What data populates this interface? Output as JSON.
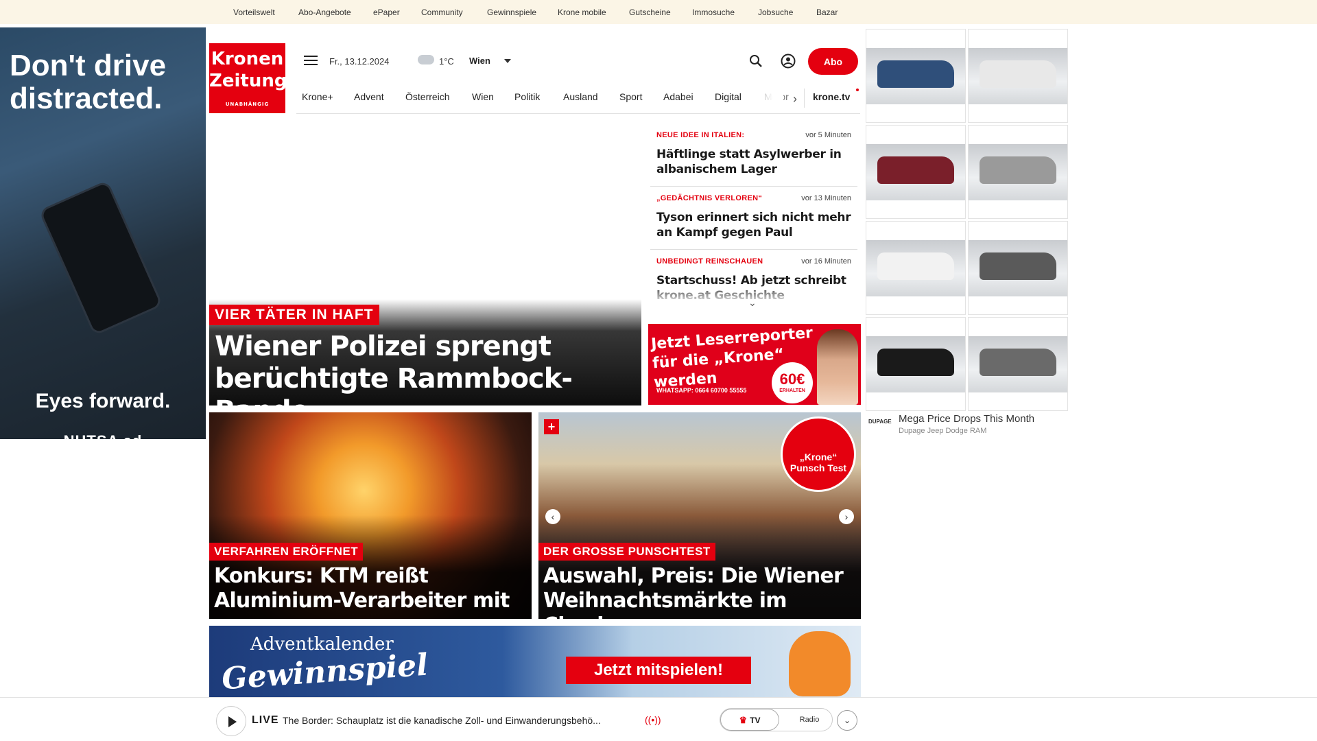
{
  "topbar": {
    "items": [
      "Vorteilswelt",
      "Abo-Angebote",
      "ePaper",
      "Community",
      "Gewinnspiele",
      "Krone mobile",
      "Gutscheine",
      "Immosuche",
      "Jobsuche",
      "Bazar"
    ]
  },
  "ad_left": {
    "headline": "Don't drive distracted.",
    "tagline": "Eyes forward.",
    "brand": "NHTSA  ad"
  },
  "header": {
    "logo_line1": "Kronen",
    "logo_line2": "Zeitung",
    "logo_line3": "UNABHÄNGIG",
    "date": "Fr., 13.12.2024",
    "temperature": "1°C",
    "city": "Wien",
    "abo_label": "Abo"
  },
  "nav": {
    "items": [
      "Krone+",
      "Advent",
      "Österreich",
      "Wien",
      "Politik",
      "Ausland",
      "Sport",
      "Adabei",
      "Digital",
      "Motor"
    ],
    "right_label": "krone.tv"
  },
  "hero": {
    "tag": "VIER TÄTER IN HAFT",
    "title": "Wiener Polizei sprengt berüchtigte Rammbock-Bande"
  },
  "news": [
    {
      "kicker": "NEUE IDEE IN ITALIEN:",
      "time": "vor 5 Minuten",
      "title": "Häftlinge statt Asylwerber in albanischem Lager"
    },
    {
      "kicker": "„GEDÄCHTNIS VERLOREN“",
      "time": "vor 13 Minuten",
      "title": "Tyson erinnert sich nicht mehr an Kampf gegen Paul"
    },
    {
      "kicker": "UNBEDINGT REINSCHAUEN",
      "time": "vor 16 Minuten",
      "title": "Startschuss! Ab jetzt schreibt krone.at Geschichte"
    }
  ],
  "reporter_ad": {
    "title": "Jetzt Leserreporter für die „Krone“ werden",
    "whatsapp": "WHATSAPP: 0664 60700 55555",
    "amount": "60€",
    "amount_sub": "ERHALTEN"
  },
  "cards": [
    {
      "tag": "VERFAHREN ERÖFFNET",
      "title": "Konkurs: KTM reißt Aluminium-Verarbeiter mit"
    },
    {
      "tag": "DER GROSSE PUNSCHTEST",
      "title": "Auswahl, Preis: Die Wiener Weihnachtsmärkte im Check",
      "badge": "„Krone“ Punsch Test"
    }
  ],
  "advent": {
    "word1": "Adventkalender",
    "word2": "Gewinnspiel",
    "cta": "Jetzt mitspielen!"
  },
  "livebar": {
    "live_label": "LIVE",
    "title": "The Border: Schauplatz ist die kanadische Zoll- und Einwanderungsbehö...",
    "tv_label": "TV",
    "radio_label": "Radio"
  },
  "ad_right": {
    "caption": "Mega Price Drops This Month",
    "advertiser": "Dupage Jeep Dodge RAM",
    "logo_text": "DUPAGE",
    "car_colors": [
      "#2f4f7a",
      "#e8e8e8",
      "#7a1f2a",
      "#9a9a9a",
      "#f2f2f2",
      "#5a5a5a",
      "#1a1a1a",
      "#6a6a6a"
    ]
  },
  "colors": {
    "brand_red": "#e4000f",
    "topbar_bg": "#fbf5e6"
  }
}
